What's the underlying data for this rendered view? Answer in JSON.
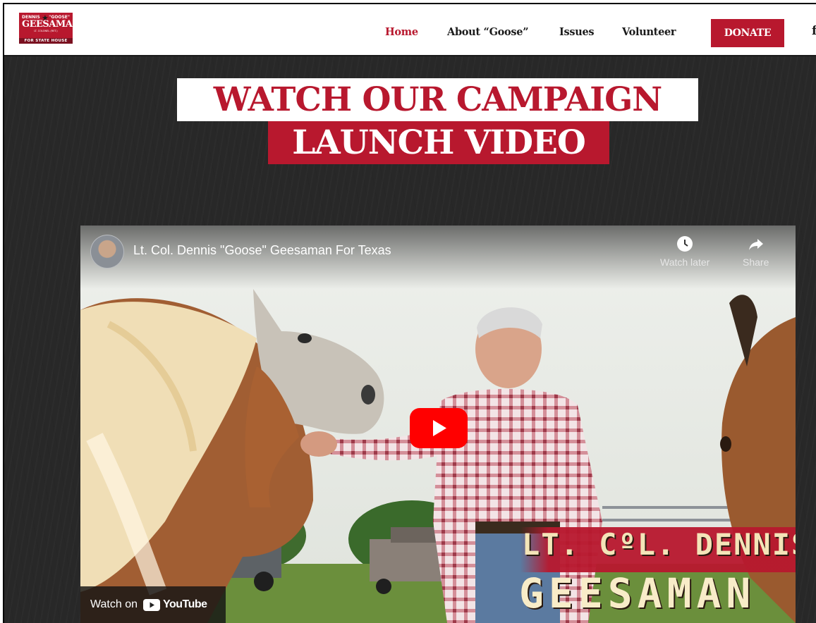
{
  "header": {
    "logo": {
      "top_left": "DENNIS",
      "top_right": "\"GOOSE\"",
      "name": "GEESAMAN",
      "sub": "LT. COLONEL (RET.)",
      "tagline": "FOR STATE HOUSE"
    },
    "nav": [
      {
        "label": "Home",
        "active": true
      },
      {
        "label": "About “Goose”",
        "active": false
      },
      {
        "label": "Issues",
        "active": false
      },
      {
        "label": "Volunteer",
        "active": false
      }
    ],
    "donate_label": "DONATE",
    "social_icon": "f"
  },
  "hero": {
    "title_line1": "WATCH OUR CAMPAIGN",
    "title_line2": "LAUNCH VIDEO"
  },
  "video": {
    "channel_title": "Lt. Col. Dennis \"Goose\" Geesaman For Texas",
    "watch_later_label": "Watch later",
    "share_label": "Share",
    "watch_on_label": "Watch on",
    "youtube_label": "YouTube",
    "lower_third_line1": "LT. CºL. DENNIS",
    "lower_third_line2": "GEESAMAN",
    "icons": [
      "clock-icon",
      "share-arrow-icon",
      "play-icon",
      "youtube-logo-icon"
    ]
  },
  "colors": {
    "brand_red": "#b8182e",
    "dark_bg": "#282828",
    "nav_text": "#1b1b1b",
    "youtube_red": "#ff0000"
  }
}
